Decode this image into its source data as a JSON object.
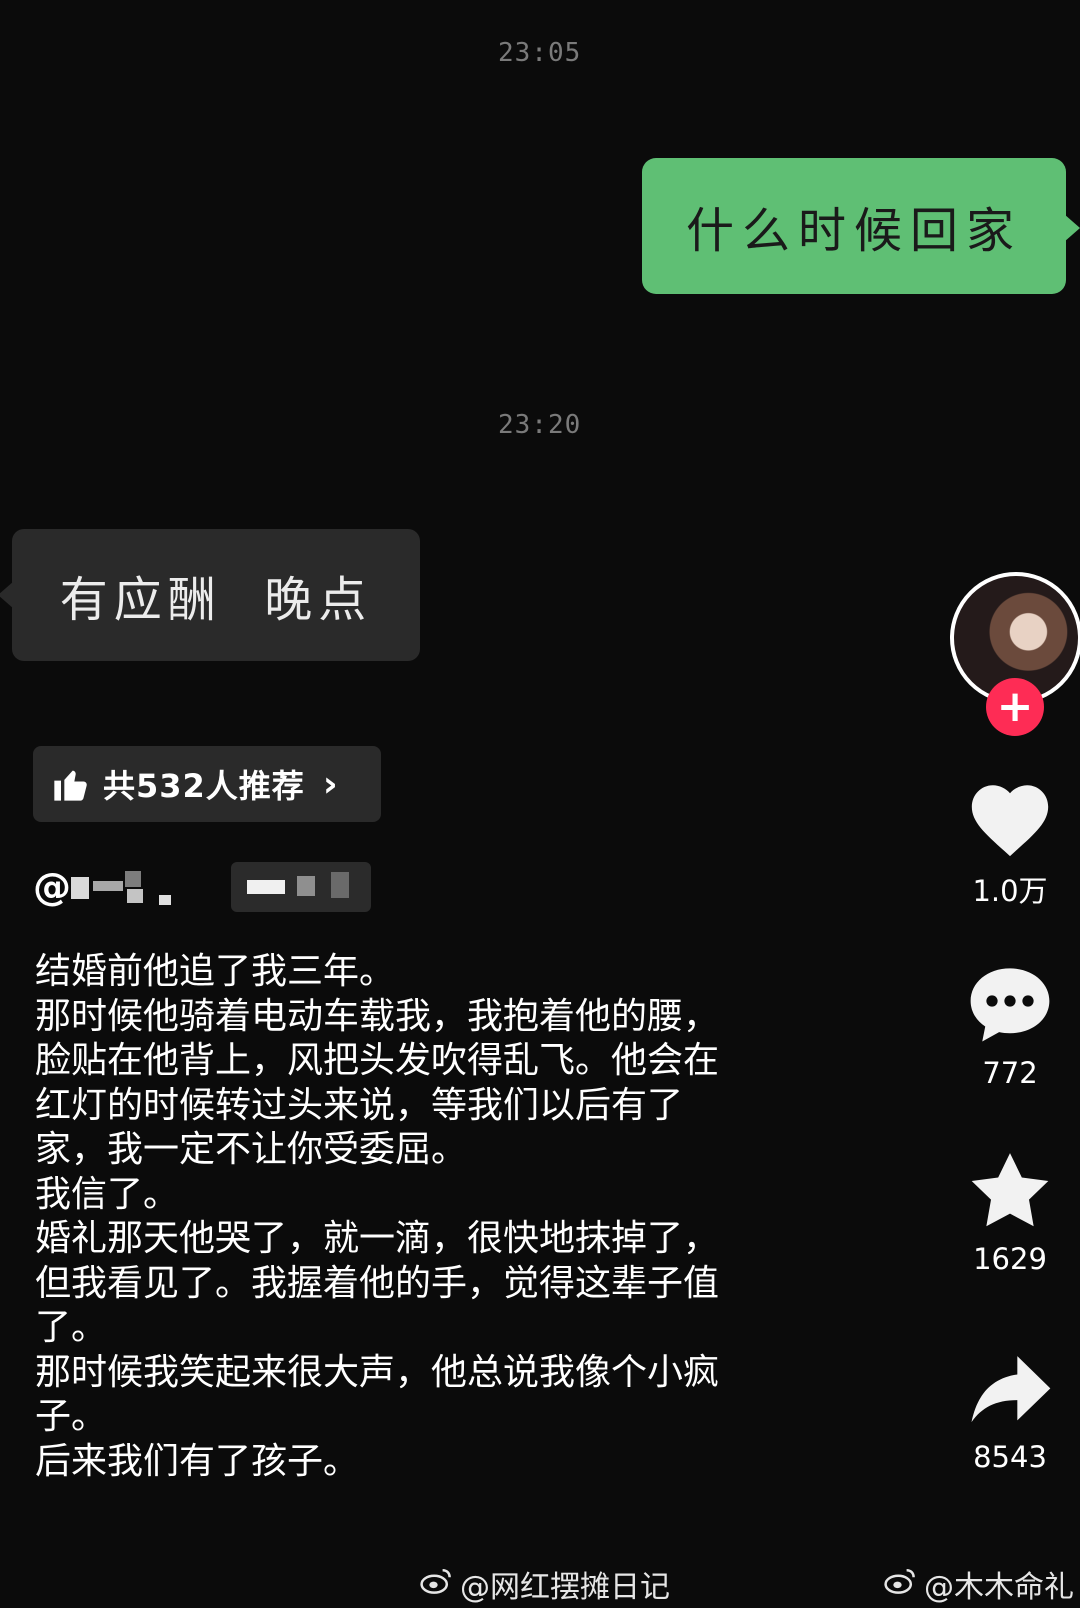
{
  "chat": {
    "time_1": "23:05",
    "sent_message": "什么时候回家",
    "time_2": "23:20",
    "received_message": "有应酬  晚点"
  },
  "recommend": {
    "label": "共532人推荐",
    "chevron": "›"
  },
  "author": {
    "at_symbol": "@"
  },
  "caption": {
    "lines": [
      "结婚前他追了我三年。",
      "那时候他骑着电动车载我，我抱着他的腰，",
      "脸贴在他背上，风把头发吹得乱飞。他会在",
      "红灯的时候转过头来说，等我们以后有了",
      "家，我一定不让你受委屈。",
      "我信了。",
      "婚礼那天他哭了，就一滴，很快地抹掉了，",
      "但我看见了。我握着他的手，觉得这辈子值",
      "了。",
      "那时候我笑起来很大声，他总说我像个小疯",
      "子。",
      "后来我们有了孩子。"
    ]
  },
  "rail": {
    "follow_label": "+",
    "like_count": "1.0万",
    "comment_count": "772",
    "favorite_count": "1629",
    "share_count": "8543"
  },
  "watermarks": {
    "left": "@网红摆摊日记",
    "right": "@木木命礼"
  },
  "colors": {
    "background": "#0b0b0b",
    "sent_bubble": "#5fbf74",
    "received_bubble": "#2a2a2a",
    "follow_button": "#fe2c55"
  },
  "icons": [
    "thumbs-up-icon",
    "chevron-right-icon",
    "heart-icon",
    "comment-icon",
    "star-icon",
    "share-icon",
    "weibo-icon"
  ]
}
